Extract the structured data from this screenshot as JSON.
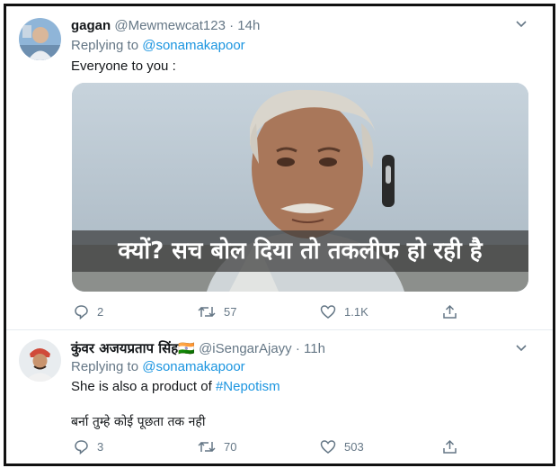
{
  "tweets": [
    {
      "name": "gagan",
      "handle": "@Mewmewcat123",
      "time": "· 14h",
      "replying_prefix": "Replying to ",
      "replying_to": "@sonamakapoor",
      "text": "Everyone to you :",
      "media_caption": "क्यों? सच बोल दिया तो तकलीफ हो रही है",
      "replies": "2",
      "retweets": "57",
      "likes": "1.1K"
    },
    {
      "name": "कुंवर अजयप्रताप सिंह",
      "flag": "🇮🇳",
      "handle": "@iSengarAjayy",
      "time": "· 11h",
      "replying_prefix": "Replying to ",
      "replying_to": "@sonamakapoor",
      "text_prefix": "She is also a product of ",
      "hashtag": "#Nepotism",
      "text_line2": "बर्ना तुम्हे कोई पूछता तक नही",
      "replies": "3",
      "retweets": "70",
      "likes": "503"
    }
  ],
  "icons": {
    "caret": "chevron-down-icon",
    "reply": "reply-icon",
    "retweet": "retweet-icon",
    "like": "heart-icon",
    "share": "share-icon"
  },
  "colors": {
    "link": "#1b95e0",
    "secondary": "#657786",
    "text": "#14171a"
  }
}
